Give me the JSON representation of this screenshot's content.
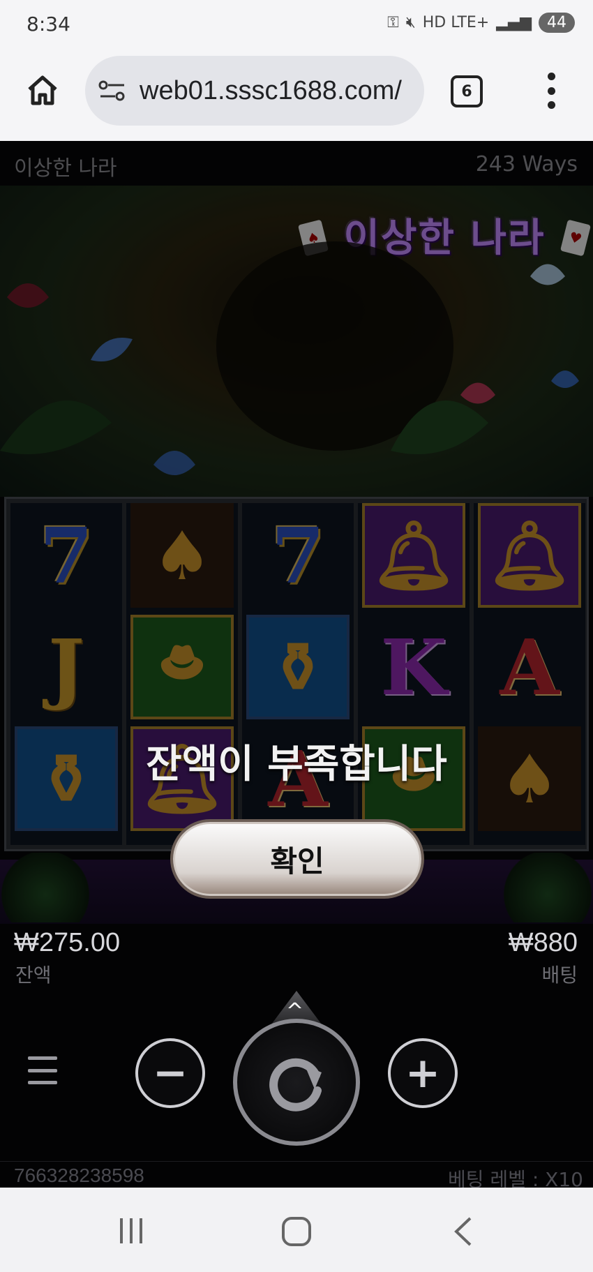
{
  "status": {
    "time": "8:34",
    "indicators": "HD LTE+",
    "battery": "44"
  },
  "browser": {
    "url": "web01.sssc1688.com/",
    "tab_count": "6"
  },
  "game": {
    "title": "이상한 나라",
    "ways": "243 Ways",
    "logo": "이상한 나라",
    "reels": [
      [
        "7",
        "J",
        "vase"
      ],
      [
        "spade",
        "hat",
        "bell"
      ],
      [
        "7",
        "vase",
        "A"
      ],
      [
        "bell",
        "K",
        "hat"
      ],
      [
        "bell",
        "A",
        "spade"
      ]
    ],
    "popup": {
      "message": "잔액이 부족합니다",
      "confirm_label": "확인"
    },
    "balance": {
      "value": "₩275.00",
      "label": "잔액"
    },
    "bet": {
      "value": "₩880",
      "label": "배팅"
    },
    "controls": {
      "minus": "−",
      "plus": "+",
      "spin_up": "^"
    },
    "footer": {
      "round_id": "766328238598",
      "bet_level": "베팅 레벨 : X10"
    }
  },
  "colors": {
    "accent": "#c58cff",
    "background": "#060608",
    "browser_bar": "#f5f5f7"
  }
}
